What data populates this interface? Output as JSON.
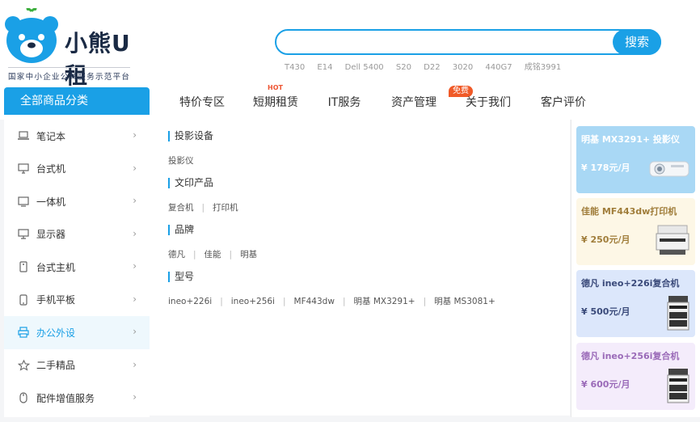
{
  "logo": {
    "brand": "小熊U租",
    "subtitle": "国家中小企业公共服务示范平台"
  },
  "search": {
    "value": "",
    "placeholder": "",
    "button": "搜索"
  },
  "hotwords": [
    "T430",
    "E14",
    "Dell 5400",
    "S20",
    "D22",
    "3020",
    "440G7",
    "成铭3991"
  ],
  "nav": {
    "all_categories": "全部商品分类",
    "items": [
      {
        "label": "特价专区"
      },
      {
        "label": "短期租赁",
        "tag": "HOT"
      },
      {
        "label": "IT服务"
      },
      {
        "label": "资产管理",
        "tag": "免费"
      },
      {
        "label": "关于我们"
      },
      {
        "label": "客户评价"
      }
    ]
  },
  "sidebar": {
    "items": [
      {
        "label": "笔记本",
        "icon": "laptop-icon"
      },
      {
        "label": "台式机",
        "icon": "desktop-icon"
      },
      {
        "label": "一体机",
        "icon": "all-in-one-icon"
      },
      {
        "label": "显示器",
        "icon": "monitor-icon"
      },
      {
        "label": "台式主机",
        "icon": "tower-icon"
      },
      {
        "label": "手机平板",
        "icon": "phone-icon"
      },
      {
        "label": "办公外设",
        "icon": "printer-icon",
        "active": true
      },
      {
        "label": "二手精品",
        "icon": "star-icon"
      },
      {
        "label": "配件增值服务",
        "icon": "mouse-icon"
      }
    ]
  },
  "content": {
    "groups": [
      {
        "title": "投影设备",
        "links": [
          "投影仪"
        ]
      },
      {
        "title": "文印产品",
        "links": [
          "复合机",
          "打印机"
        ]
      },
      {
        "title": "品牌",
        "links": [
          "德凡",
          "佳能",
          "明基"
        ]
      },
      {
        "title": "型号",
        "links": [
          "ineo+226i",
          "ineo+256i",
          "MF443dw",
          "明基 MX3291+",
          "明基 MS3081+"
        ]
      }
    ]
  },
  "promos": [
    {
      "title": "明基 MX3291+ 投影仪",
      "price": "¥ 178元/月",
      "bg": "#a9d8f5",
      "color": "#ffffff",
      "image": "projector-image"
    },
    {
      "title": "佳能 MF443dw打印机",
      "price": "¥ 250元/月",
      "bg": "#fdf7e6",
      "color": "#a07d3a",
      "image": "printer-image"
    },
    {
      "title": "德凡 ineo+226i复合机",
      "price": "¥ 500元/月",
      "bg": "#dce7fb",
      "color": "#3a4a7a",
      "image": "copier-image"
    },
    {
      "title": "德凡 ineo+256i复合机",
      "price": "¥ 600元/月",
      "bg": "#f4ecfb",
      "color": "#9a6ab8",
      "image": "copier-image"
    }
  ]
}
